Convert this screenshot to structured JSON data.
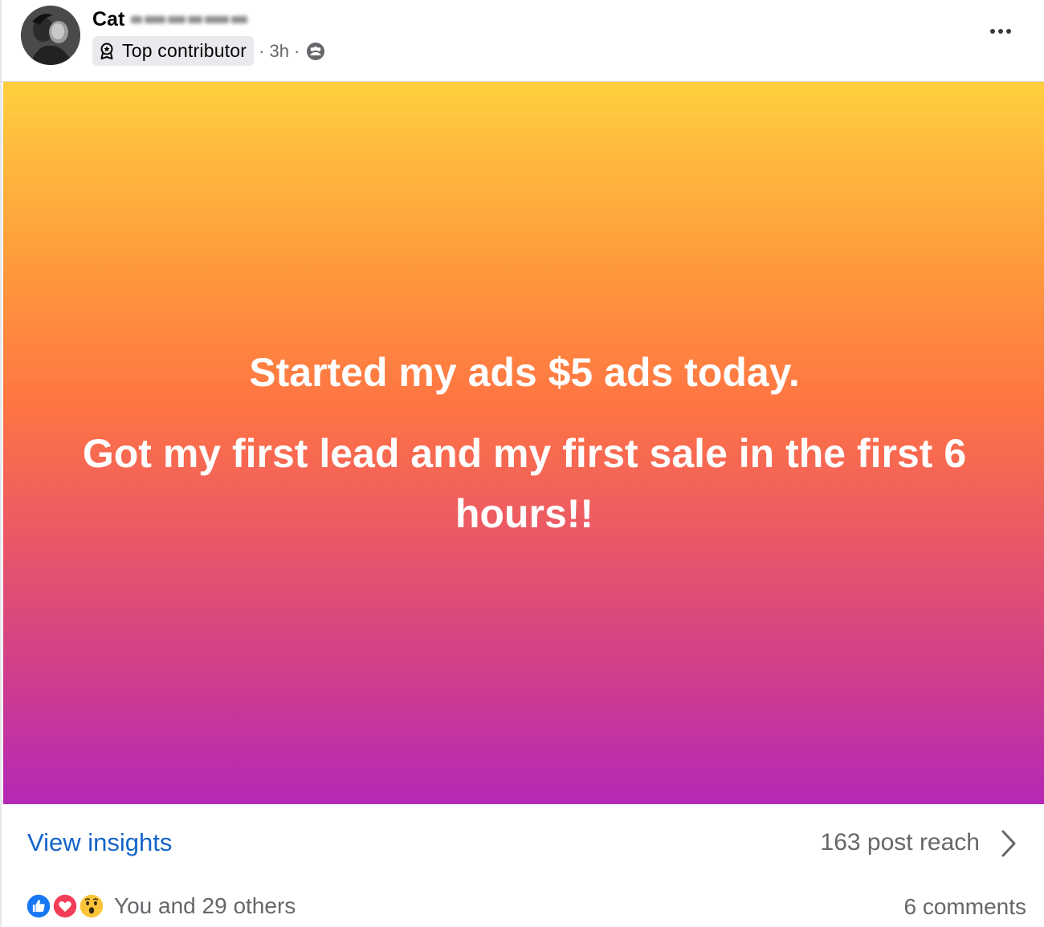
{
  "author": {
    "first_name": "Cat",
    "last_name_redacted": true
  },
  "meta": {
    "badge_label": "Top contributor",
    "badge_icon": "top-contributor-icon",
    "separator": "·",
    "time": "3h",
    "audience_icon": "group-members-icon"
  },
  "header": {
    "more_icon": "more-options-icon"
  },
  "post": {
    "line_1": "Started my ads $5 ads today.",
    "line_2": "Got my first lead and my first sale in the first 6 hours!!",
    "background_gradient": [
      "#ffcf3e",
      "#ff7443",
      "#b428b6"
    ]
  },
  "insights": {
    "view_label": "View insights",
    "reach_label": "163 post reach",
    "link_color": "#1464c8"
  },
  "reactions": {
    "icons": [
      "like-icon",
      "love-icon",
      "wow-icon"
    ],
    "summary": "You and 29 others",
    "comments": "6 comments"
  }
}
